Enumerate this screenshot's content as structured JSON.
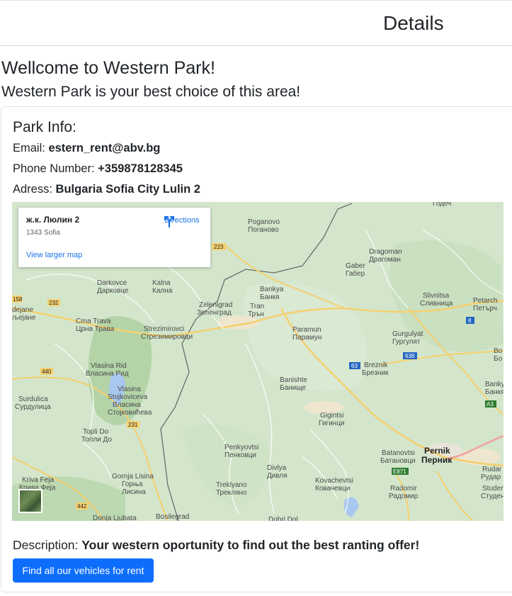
{
  "header": {
    "title": "Details"
  },
  "hero": {
    "welcome": "Wellcome to Western Park!",
    "tagline": "Western Park is your best choice of this area!"
  },
  "park_info": {
    "title": "Park Info:",
    "email_label": "Email:",
    "email_value": "estern_rent@abv.bg",
    "phone_label": "Phone Number:",
    "phone_value": "+359878128345",
    "address_label": "Adress:",
    "address_value": "Bulgaria Sofia City Lulin 2",
    "description_label": "Description:",
    "description_value": "Your western oportunity to find out the best ranting offer!",
    "cta_label": "Find all our vehicles for rent"
  },
  "map": {
    "popup": {
      "place": "ж.к. Люлин 2",
      "sub": "1343 Sofia",
      "directions": "Directions",
      "larger_map": "View larger map"
    },
    "places": [
      "Poganovo",
      "Поганово",
      "Dragoman",
      "Драгоман",
      "Gaber",
      "Габер",
      "Darkovce",
      "Дарковце",
      "Kalna",
      "Кална",
      "Bankya",
      "Банкя",
      "Zelenigrad",
      "Зеленград",
      "Tran",
      "Трън",
      "Slivnitsa",
      "Сливница",
      "Petarch",
      "Петърч",
      "Crna Trava",
      "Црна Трава",
      "Strezimirovci",
      "Стрезимировци",
      "Paramun",
      "Парамун",
      "Gurgulyat",
      "Гургулят",
      "Vlasina Rid",
      "Власина Рид",
      "Breznik",
      "Брезник",
      "Banishte",
      "Банище",
      "Vlasina",
      "Stojkovićeva",
      "Власина",
      "Стојковићева",
      "Surdulica",
      "Сурдулица",
      "Gigintsi",
      "Гигинци",
      "Topli Do",
      "Топли До",
      "Penkyovtsi",
      "Пенковци",
      "Batanovtsi",
      "Батановци",
      "Pernik",
      "Перник",
      "Divlya",
      "Дивля",
      "Kovachevtsi",
      "Ковачевци",
      "Kriva Feja",
      "Крива Феја",
      "Gornja Lisina",
      "Горња",
      "Лисина",
      "Treklyano",
      "Трекляно",
      "Radomir",
      "Радомир",
      "Studena",
      "Студена",
      "Donja Ljubata",
      "Bosilegrad",
      "Dobri Dol",
      "Bankya",
      "Банкя",
      "Rudar",
      "Рудар",
      "Годеч",
      "dejane",
      "љејане",
      "Bo",
      "Бо"
    ],
    "road_numbers": [
      "223",
      "158",
      "232",
      "440",
      "231",
      "442",
      "63",
      "638",
      "8",
      "A3",
      "E871"
    ]
  }
}
